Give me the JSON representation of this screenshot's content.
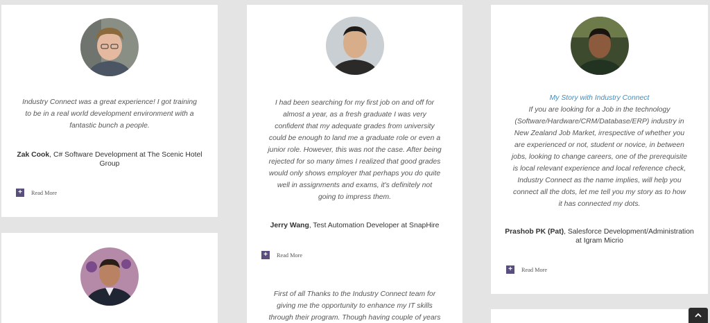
{
  "testimonials": [
    {
      "quote": "Industry Connect was a great experience! I got training to be in a real world development environment with a fantastic bunch a people.",
      "author_name": "Zak Cook",
      "author_role": ", C# Software Development at The Scenic Hotel Group",
      "read_more": "Read More"
    },
    {
      "quote": "I had been searching for my first job on and off for almost a year, as a fresh graduate I was very confident that my adequate grades from university could be enough to land me a graduate role or even a junior role. However, this was not the case. After being rejected for so many times I realized that good grades would only shows employer that perhaps you do quite well in assignments and exams, it's definitely not going to impress them.",
      "author_name": "Jerry Wang",
      "author_role": ", Test Automation Developer at SnapHire",
      "read_more": "Read More"
    },
    {
      "title": "My Story with Industry Connect",
      "quote": "If you are looking for a Job in the technology (Software/Hardware/CRM/Database/ERP) industry in New Zealand Job Market, irrespective of whether you are experienced or not, student or novice, in between jobs, looking to change careers, one of the prerequisite is local relevant experience and local reference check, Industry Connect as the name implies, will help you connect all the dots, let me tell you my story as to how it has connected my dots.",
      "author_name": "Prashob PK (Pat)",
      "author_role": ", Salesforce Development/Administration at Igram Micrio",
      "read_more": "Read More"
    },
    {
      "quote": "First of all Thanks to the Industry Connect team for giving me the opportunity to enhance my IT skills through their program. Though having couple of years"
    }
  ],
  "icons": {
    "plus": "+",
    "scroll_top": "chevron-up-icon"
  },
  "colors": {
    "accent": "#5a4e7e",
    "title_link": "#3a8fc4",
    "background": "#e4e4e4"
  }
}
